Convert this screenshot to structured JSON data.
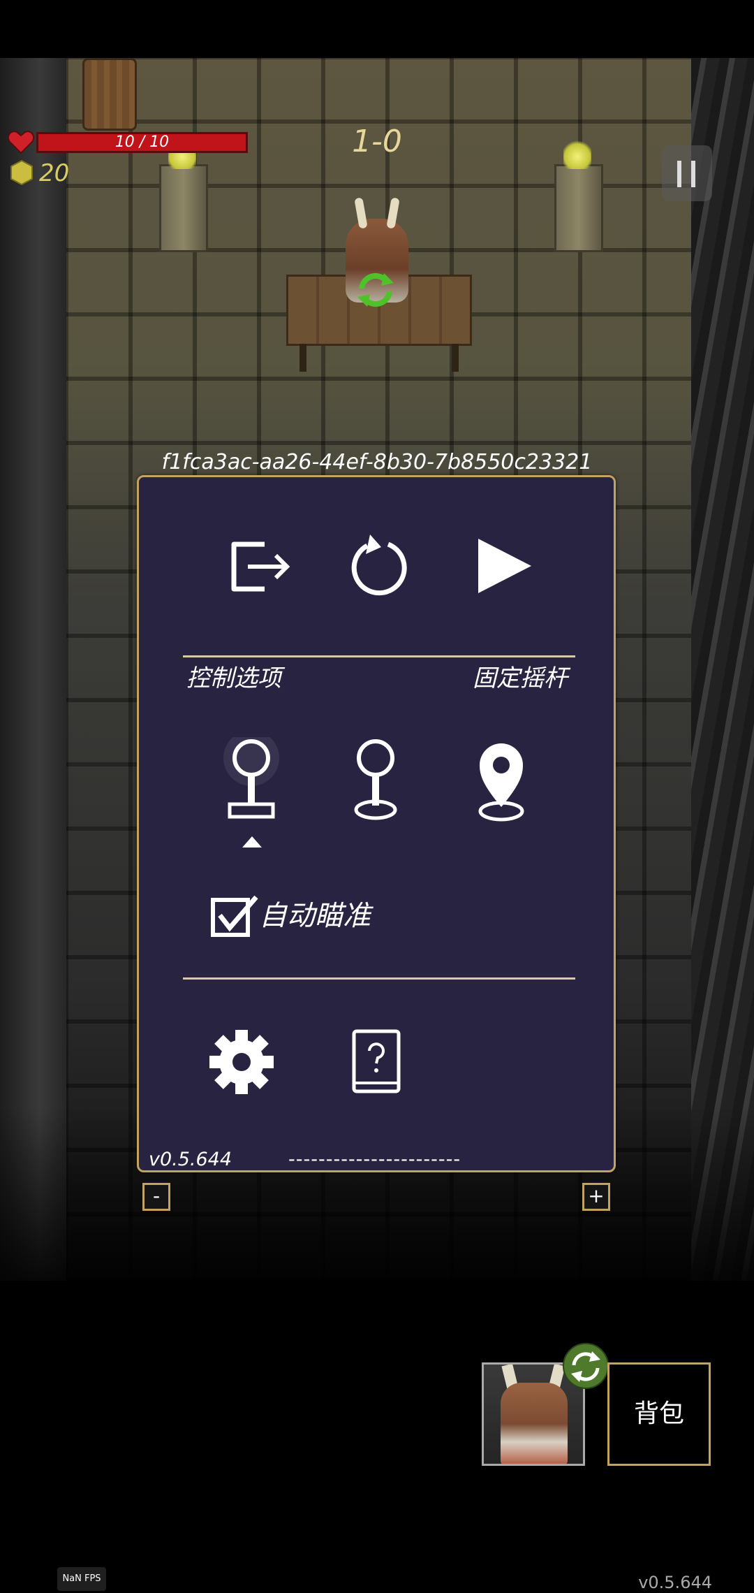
{
  "hud": {
    "hp_text": "10 / 10",
    "coins": "20",
    "level": "1-0",
    "seed": "f1fca3ac-aa26-44ef-8b30-7b8550c23321",
    "hp_fraction": 1.0
  },
  "menu": {
    "top_buttons": [
      "exit-icon",
      "restart-icon",
      "play-icon"
    ],
    "control_options_label": "控制选项",
    "fixed_joystick_label": "固定摇杆",
    "joystick_options": [
      "fixed-joystick-icon",
      "floating-joystick-icon",
      "tap-to-move-icon"
    ],
    "selected_joystick_index": 0,
    "auto_aim_label": "自动瞄准",
    "auto_aim_checked": true,
    "bottom_buttons": [
      "gear-icon",
      "help-book-icon"
    ],
    "version": "v0.5.644",
    "dashes": "-----------------------"
  },
  "zoom": {
    "minus": "-",
    "plus": "+"
  },
  "bottom": {
    "backpack_label": "背包",
    "fps": "NaN FPS",
    "version": "v0.5.644"
  },
  "colors": {
    "panel_bg": "#282340",
    "panel_border": "#c3a362",
    "hp_red": "#c0141a",
    "coin_yellow": "#d8cc66",
    "swap_green": "#4f7a2c"
  }
}
